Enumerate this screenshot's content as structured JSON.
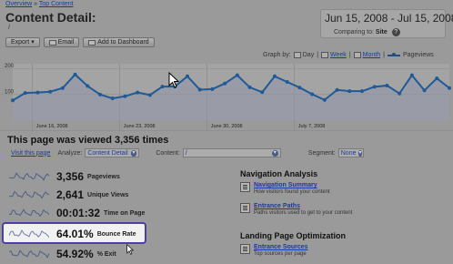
{
  "breadcrumb": {
    "overview": "Overview",
    "separator": "»",
    "top_content": "Top Content"
  },
  "page": {
    "title": "Content Detail:",
    "path": "/"
  },
  "date_range": {
    "dates": "Jun 15, 2008 - Jul 15, 2008",
    "comparing_label": "Comparing to:",
    "comparing_value": "Site"
  },
  "toolbar": {
    "export": "Export",
    "export_arrow": "▾",
    "email": "Email",
    "dashboard": "Add to Dashboard"
  },
  "graph_by": {
    "label": "Graph by:",
    "day": "Day",
    "week": "Week",
    "month": "Month",
    "metric": "Pageviews"
  },
  "chart_data": {
    "type": "line",
    "series": [
      {
        "name": "Pageviews",
        "values": [
          77,
          106,
          108,
          111,
          125,
          178,
          133,
          100,
          85,
          93,
          108,
          98,
          131,
          131,
          171,
          119,
          121,
          143,
          175,
          128,
          109,
          171,
          149,
          127,
          101,
          79,
          118,
          113,
          113,
          130,
          135,
          104,
          175,
          116,
          163,
          125
        ]
      }
    ],
    "ylim": [
      0,
      220
    ],
    "yticks": [
      "200",
      "100"
    ],
    "xticks": [
      {
        "label": "June 16, 2008",
        "index": 1
      },
      {
        "label": "June 23, 2008",
        "index": 8
      },
      {
        "label": "June 30, 2008",
        "index": 15
      },
      {
        "label": "July 7, 2008",
        "index": 22
      }
    ],
    "color": "#1f5a96"
  },
  "summary": {
    "heading": "This page was viewed 3,356 times",
    "visit_link": "Visit this page",
    "analyze_label": "Analyze:",
    "analyze_value": "Content Detail",
    "content_label": "Content:",
    "content_value": "/",
    "segment_label": "Segment:",
    "segment_value": "None"
  },
  "metrics": [
    {
      "value": "3,356",
      "label": "Pageviews"
    },
    {
      "value": "2,641",
      "label": "Unique Views"
    },
    {
      "value": "00:01:32",
      "label": "Time on Page"
    },
    {
      "value": "64.01%",
      "label": "Bounce Rate"
    },
    {
      "value": "54.92%",
      "label": "% Exit"
    }
  ],
  "nav_analysis": {
    "heading": "Navigation Analysis",
    "items": [
      {
        "title": "Navigation Summary",
        "desc": "How visitors found your content"
      },
      {
        "title": "Entrance Paths",
        "desc": "Paths visitors used to get to your content"
      }
    ]
  },
  "landing": {
    "heading": "Landing Page Optimization",
    "items": [
      {
        "title": "Entrance Sources",
        "desc": "Top sources per page"
      }
    ]
  },
  "colors": {
    "accent": "#1f5a96",
    "highlight_border": "#4d3fa6",
    "link": "#1a3b9c",
    "background": "#9a9a9a"
  }
}
